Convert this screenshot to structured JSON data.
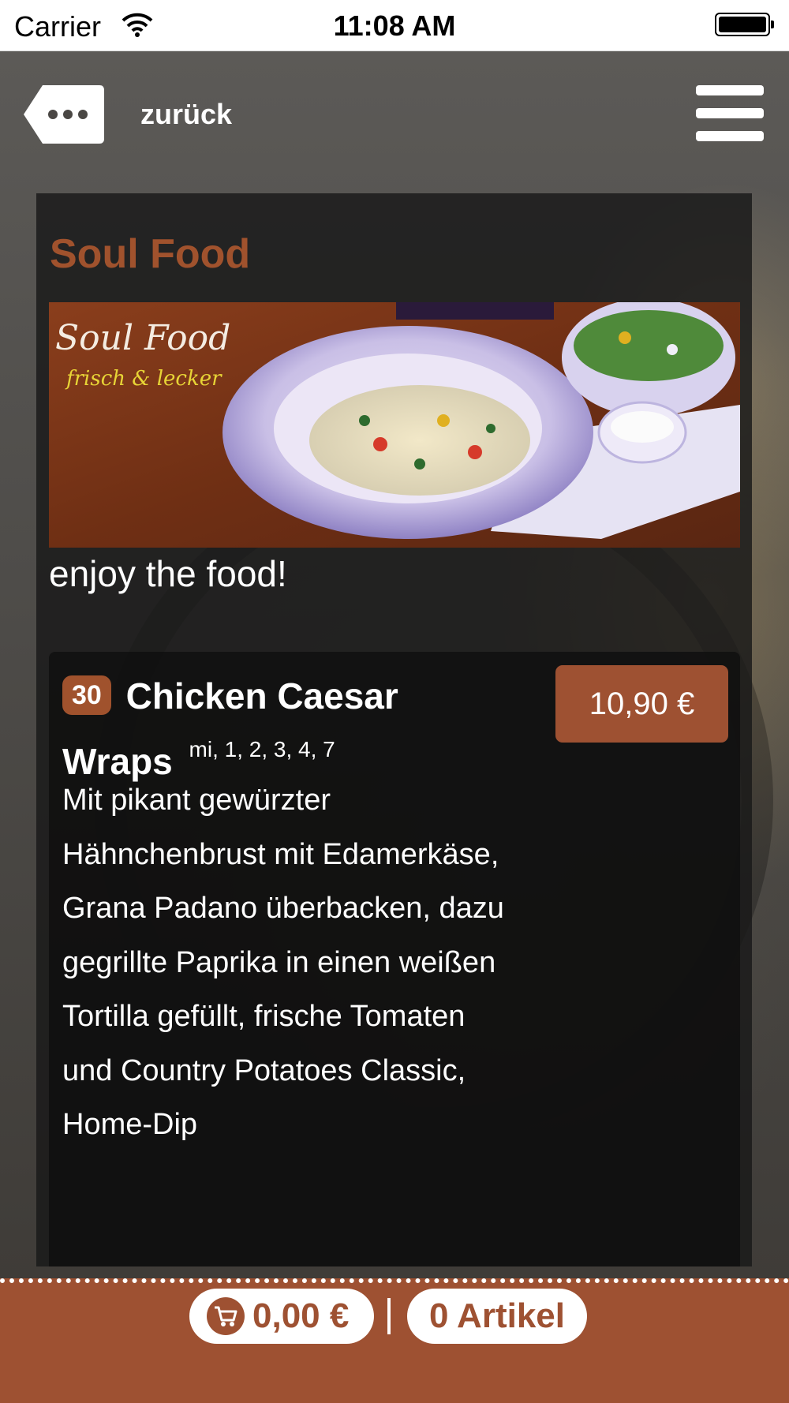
{
  "status_bar": {
    "carrier": "Carrier",
    "time": "11:08 AM"
  },
  "nav": {
    "back_label": "zurück",
    "back_icon": "more-dots-icon",
    "menu_icon": "hamburger-icon"
  },
  "page": {
    "title": "Soul Food",
    "banner_script_title": "Soul Food",
    "banner_script_subtitle": "frisch & lecker",
    "tagline": "enjoy the food!"
  },
  "menu_item": {
    "number": "30",
    "name": "Chicken Caesar Wraps",
    "allergens": "mi, 1, 2, 3, 4, 7",
    "price": "10,90 €",
    "description": "Mit pikant gewürzter Hähnchenbrust mit Edamerkäse, Grana Padano überbacken, dazu gegrillte Paprika in einen weißen Tortilla gefüllt, frische Tomaten und Country Potatoes Classic, Home-Dip"
  },
  "cart": {
    "total": "0,00 €",
    "separator": "|",
    "count": "0 Artikel",
    "icon": "cart-icon"
  },
  "colors": {
    "accent": "#a0522d",
    "cart_bar": "#9e5132",
    "panel": "#191919"
  }
}
